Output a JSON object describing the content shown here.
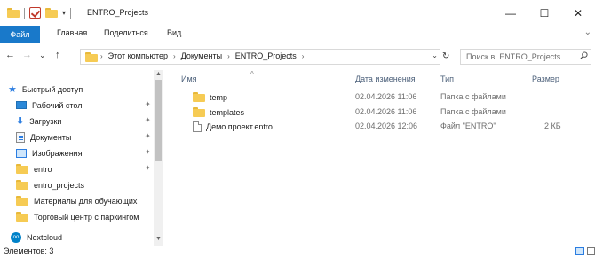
{
  "window": {
    "title": "ENTRO_Projects",
    "minimize": "—",
    "maximize": "☐",
    "close": "✕",
    "qa_dropdown": "▾"
  },
  "ribbon": {
    "tabs": [
      "Файл",
      "Главная",
      "Поделиться",
      "Вид"
    ],
    "expand": "⌄"
  },
  "nav": {
    "back": "←",
    "forward": "→",
    "history": "⌄",
    "up": "↑",
    "breadcrumbs": [
      "Этот компьютер",
      "Документы",
      "ENTRO_Projects"
    ],
    "crumb_separator": "›",
    "address_dropdown": "⌄",
    "refresh": "↻",
    "search_placeholder": "Поиск в: ENTRO_Projects"
  },
  "sidebar": {
    "items": [
      {
        "label": "Быстрый доступ",
        "icon": "star-icon",
        "pinned": false
      },
      {
        "label": "Рабочий стол",
        "icon": "desktop-icon",
        "pinned": true
      },
      {
        "label": "Загрузки",
        "icon": "download-icon",
        "pinned": true
      },
      {
        "label": "Документы",
        "icon": "documents-icon",
        "pinned": true
      },
      {
        "label": "Изображения",
        "icon": "pictures-icon",
        "pinned": true
      },
      {
        "label": "entro",
        "icon": "folder-icon",
        "pinned": true
      },
      {
        "label": "entro_projects",
        "icon": "folder-icon",
        "pinned": false
      },
      {
        "label": "Материалы для обучающих",
        "icon": "folder-icon",
        "pinned": false
      },
      {
        "label": "Торговый центр с паркингом",
        "icon": "folder-icon",
        "pinned": false
      },
      {
        "label": "Nextcloud",
        "icon": "nextcloud-icon",
        "pinned": false
      }
    ],
    "pin_glyph": "✦",
    "scroll_up": "▲",
    "scroll_down": "▼"
  },
  "list": {
    "columns": {
      "name": "Имя",
      "date": "Дата изменения",
      "type": "Тип",
      "size": "Размер"
    },
    "sort_glyph": "^",
    "rows": [
      {
        "name": "temp",
        "date": "02.04.2026 11:06",
        "type": "Папка с файлами",
        "size": "",
        "icon": "folder-icon"
      },
      {
        "name": "templates",
        "date": "02.04.2026 11:06",
        "type": "Папка с файлами",
        "size": "",
        "icon": "folder-icon"
      },
      {
        "name": "Демо проект.entro",
        "date": "02.04.2026 12:06",
        "type": "Файл \"ENTRO\"",
        "size": "2 КБ",
        "icon": "file-icon"
      }
    ]
  },
  "status": {
    "items_count": "Элементов: 3"
  }
}
